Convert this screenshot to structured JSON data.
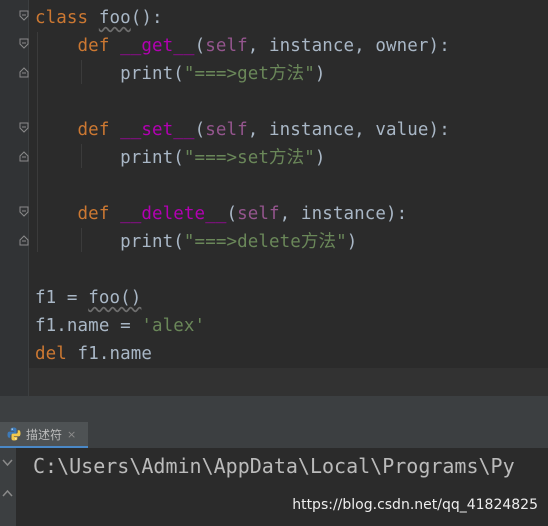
{
  "code": {
    "line1": {
      "kw": "class",
      "name": "foo",
      "rest": "():"
    },
    "line2": {
      "kw": "def",
      "name": "__get__",
      "open": "(",
      "self": "self",
      "params": ", instance, owner):"
    },
    "line3": {
      "fn": "print",
      "open": "(",
      "str": "\"===>get方法\"",
      "close": ")"
    },
    "line5": {
      "kw": "def",
      "name": "__set__",
      "open": "(",
      "self": "self",
      "params": ", instance, value):"
    },
    "line6": {
      "fn": "print",
      "open": "(",
      "str": "\"===>set方法\"",
      "close": ")"
    },
    "line8": {
      "kw": "def",
      "name": "__delete__",
      "open": "(",
      "self": "self",
      "params": ", instance):"
    },
    "line9": {
      "fn": "print",
      "open": "(",
      "str": "\"===>delete方法\"",
      "close": ")"
    },
    "line11": {
      "lhs": "f1",
      "op": " = ",
      "call": "foo()"
    },
    "line12": {
      "lhs": "f1.name = ",
      "str": "'alex'"
    },
    "line13": {
      "kw": "del",
      "rest": " f1.name"
    }
  },
  "run_panel": {
    "tab_label": "描述符",
    "close_glyph": "×",
    "console_path": "C:\\Users\\Admin\\AppData\\Local\\Programs\\Py"
  },
  "watermark": "https://blog.csdn.net/qq_41824825",
  "colors": {
    "background": "#2b2b2b",
    "keyword": "#cc7832",
    "function": "#b200b2",
    "self": "#94558d",
    "string": "#6a8759",
    "text": "#a9b7c6"
  }
}
